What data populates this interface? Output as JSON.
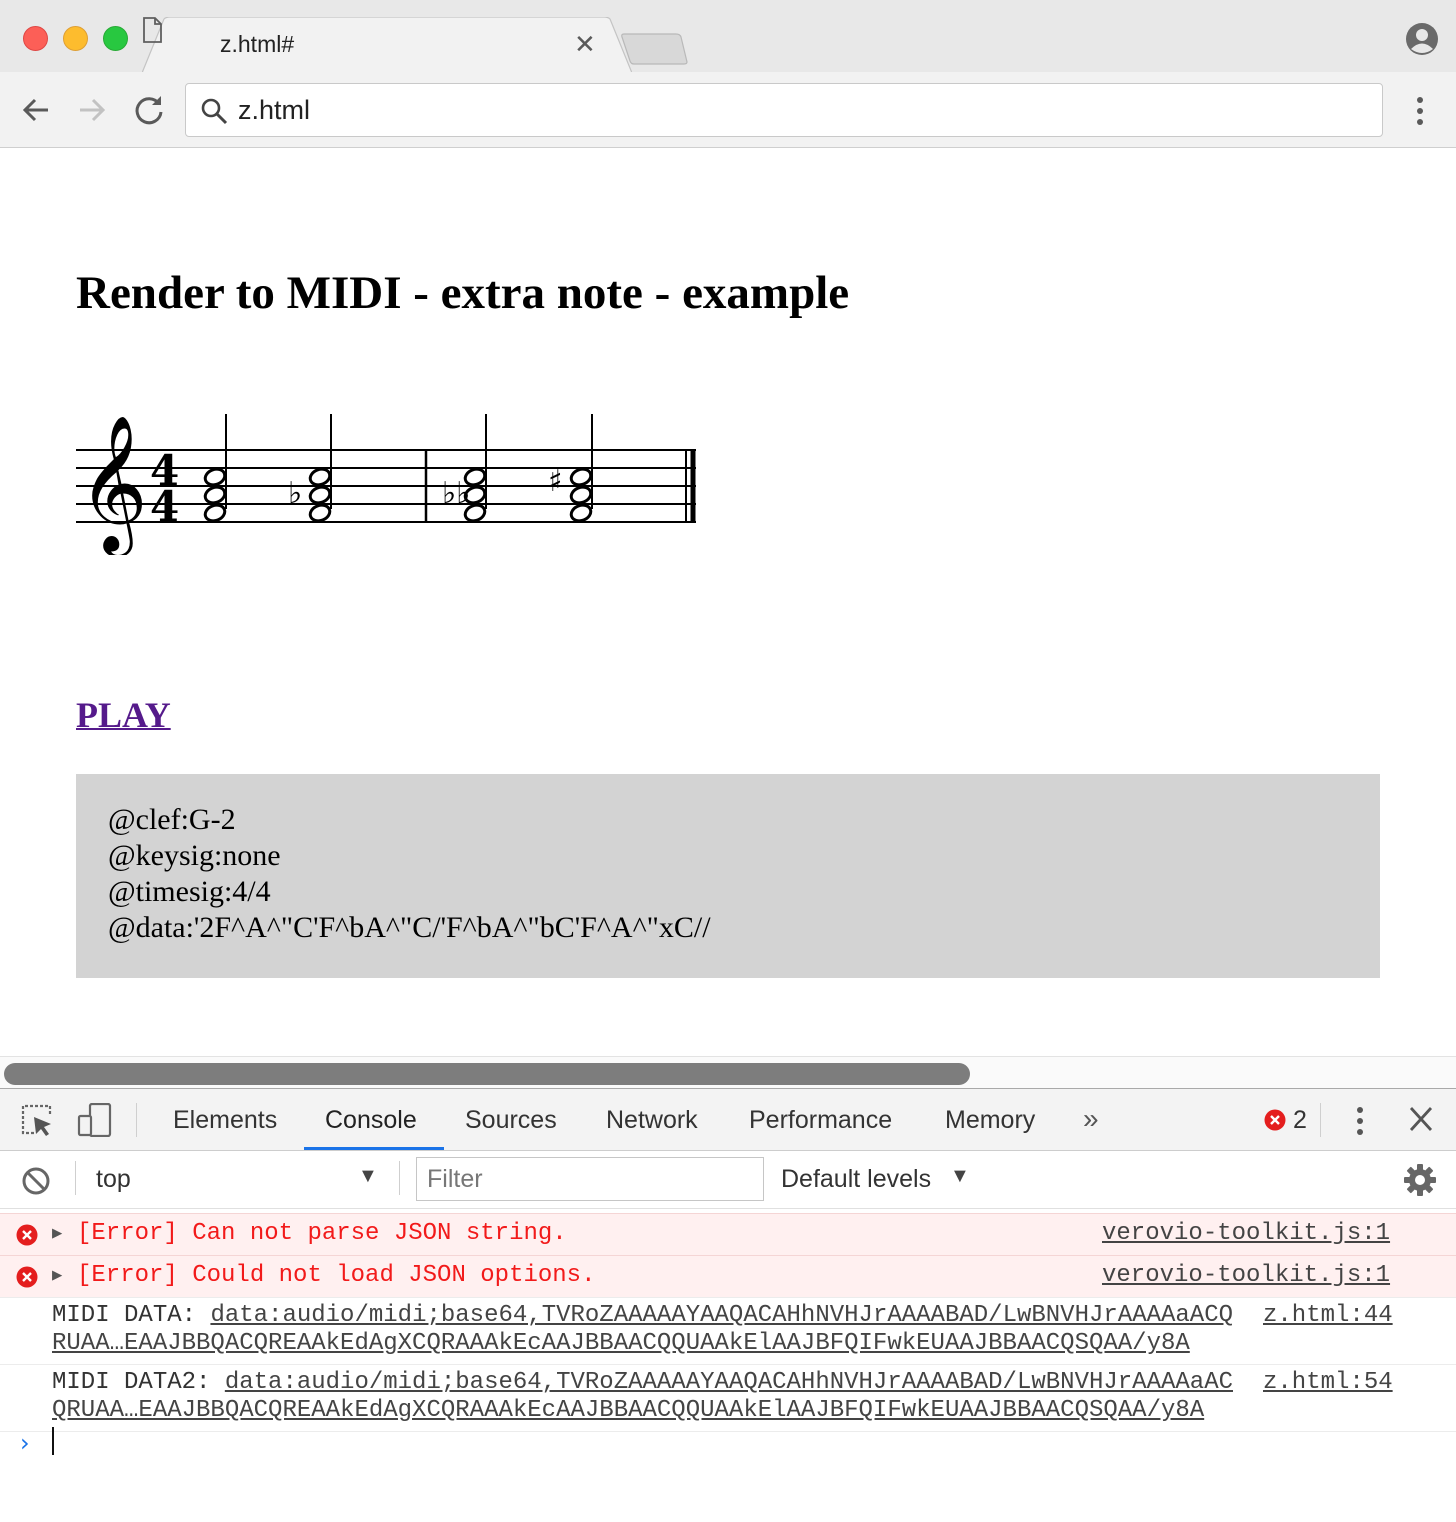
{
  "browser": {
    "tab_title": "z.html#",
    "address": "z.html"
  },
  "page": {
    "title": "Render to MIDI - extra note - example",
    "play_link": "PLAY",
    "code_lines": [
      "@clef:G-2",
      "@keysig:none",
      "@timesig:4/4",
      "@data:'2F^A^\"C'F^bA^\"C/'F^bA^\"bC'F^A^\"xC//"
    ]
  },
  "devtools": {
    "tabs": [
      "Elements",
      "Console",
      "Sources",
      "Network",
      "Performance",
      "Memory"
    ],
    "active_tab": "Console",
    "error_count": "2",
    "context": "top",
    "filter_placeholder": "Filter",
    "levels": "Default levels",
    "messages": [
      {
        "type": "error",
        "text": "[Error] Can not parse JSON string.",
        "source": "verovio-toolkit.js:1"
      },
      {
        "type": "error",
        "text": "[Error] Could not load JSON options.",
        "source": "verovio-toolkit.js:1"
      },
      {
        "type": "log",
        "label": "MIDI DATA: ",
        "link_line1": "data:audio/midi;base64,TVRoZAAAAAYAAQACAHhNVHJrAAAABAD/LwBNVHJrAAAAaACQ",
        "line2": "RUAA…EAAJBBQACQREAAkEdAgXCQRAAAkEcAAJBBAACQQUAAkElAAJBFQIFwkEUAAJBBAACQSQAA/y8A",
        "source": "z.html:44"
      },
      {
        "type": "log",
        "label": "MIDI DATA2: ",
        "link_line1": "data:audio/midi;base64,TVRoZAAAAAYAAQACAHhNVHJrAAAABAD/LwBNVHJrAAAAaAC",
        "line2": "QRUAA…EAAJBBQACQREAAkEdAgXCQRAAAkEcAAJBBAACQQUAAkElAAJBFQIFwkEUAAJBBAACQSQAA/y8A",
        "source": "z.html:54"
      }
    ]
  },
  "colors": {
    "link_visited": "#551a8b",
    "error_text": "#f21a1a",
    "error_bg": "#fff0f0",
    "accent": "#1a73e8",
    "code_box_bg": "#d3d3d3"
  },
  "icons": [
    "page-icon",
    "close-icon",
    "profile-icon",
    "back-icon",
    "forward-icon",
    "reload-icon",
    "search-icon",
    "menu-dots-icon",
    "inspect-icon",
    "device-toolbar-icon",
    "more-tabs-icon",
    "error-icon",
    "clear-console-icon",
    "settings-gear-icon",
    "prompt-chevron-icon"
  ]
}
